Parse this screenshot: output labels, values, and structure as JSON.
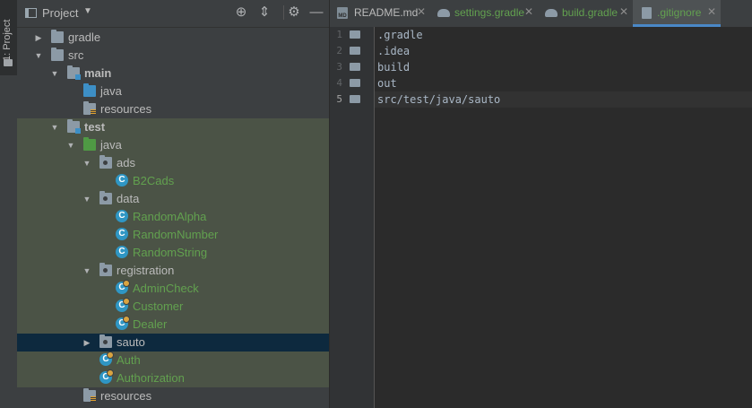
{
  "tool_strip": {
    "project_tab": "1: Project"
  },
  "project_panel": {
    "title": "Project",
    "tree": [
      {
        "label": "gradle",
        "depth": 1,
        "arrow": "collapsed",
        "icon": "folder",
        "style": "normal"
      },
      {
        "label": "src",
        "depth": 1,
        "arrow": "expanded",
        "icon": "folder",
        "style": "normal"
      },
      {
        "label": "main",
        "depth": 2,
        "arrow": "expanded",
        "icon": "module-folder",
        "style": "bold"
      },
      {
        "label": "java",
        "depth": 3,
        "arrow": "none",
        "icon": "source-folder",
        "style": "normal"
      },
      {
        "label": "resources",
        "depth": 3,
        "arrow": "none",
        "icon": "resources-folder",
        "style": "normal"
      },
      {
        "label": "test",
        "depth": 2,
        "arrow": "expanded",
        "icon": "module-folder",
        "style": "bold"
      },
      {
        "label": "java",
        "depth": 3,
        "arrow": "expanded",
        "icon": "test-source-folder",
        "style": "normal"
      },
      {
        "label": "ads",
        "depth": 4,
        "arrow": "expanded",
        "icon": "package",
        "style": "normal"
      },
      {
        "label": "B2Cads",
        "depth": 5,
        "arrow": "none",
        "icon": "class",
        "style": "green"
      },
      {
        "label": "data",
        "depth": 4,
        "arrow": "expanded",
        "icon": "package",
        "style": "normal"
      },
      {
        "label": "RandomAlpha",
        "depth": 5,
        "arrow": "none",
        "icon": "class",
        "style": "green"
      },
      {
        "label": "RandomNumber",
        "depth": 5,
        "arrow": "none",
        "icon": "class",
        "style": "green"
      },
      {
        "label": "RandomString",
        "depth": 5,
        "arrow": "none",
        "icon": "class",
        "style": "green"
      },
      {
        "label": "registration",
        "depth": 4,
        "arrow": "expanded",
        "icon": "package",
        "style": "normal"
      },
      {
        "label": "AdminCheck",
        "depth": 5,
        "arrow": "none",
        "icon": "test-class",
        "style": "green"
      },
      {
        "label": "Customer",
        "depth": 5,
        "arrow": "none",
        "icon": "test-class",
        "style": "green"
      },
      {
        "label": "Dealer",
        "depth": 5,
        "arrow": "none",
        "icon": "test-class",
        "style": "green"
      },
      {
        "label": "sauto",
        "depth": 4,
        "arrow": "collapsed",
        "icon": "package",
        "style": "normal"
      },
      {
        "label": "Auth",
        "depth": 4,
        "arrow": "none",
        "icon": "test-class",
        "style": "green"
      },
      {
        "label": "Authorization",
        "depth": 4,
        "arrow": "none",
        "icon": "test-class",
        "style": "green"
      },
      {
        "label": "resources",
        "depth": 3,
        "arrow": "none",
        "icon": "test-resources-folder",
        "style": "normal"
      }
    ]
  },
  "editor": {
    "tabs": [
      {
        "label": "README.md",
        "icon": "markdown-file-icon",
        "color": "#bbbbbb"
      },
      {
        "label": "settings.gradle",
        "icon": "gradle-icon",
        "color": "#62a14f"
      },
      {
        "label": "build.gradle",
        "icon": "gradle-icon",
        "color": "#62a14f"
      },
      {
        "label": ".gitignore",
        "icon": "gitignore-file-icon",
        "color": "#62a14f"
      }
    ],
    "active_tab": ".gitignore",
    "lines": [
      {
        "number": "1",
        "text": ".gradle"
      },
      {
        "number": "2",
        "text": ".idea"
      },
      {
        "number": "3",
        "text": "build"
      },
      {
        "number": "4",
        "text": "out"
      },
      {
        "number": "5",
        "text": "src/test/java/sauto"
      }
    ],
    "current_line": "5"
  },
  "colors": {
    "selection": "#0d293e",
    "test_highlight": "#4b5346",
    "accent": "#4a88c7",
    "green_text": "#62a14f"
  }
}
